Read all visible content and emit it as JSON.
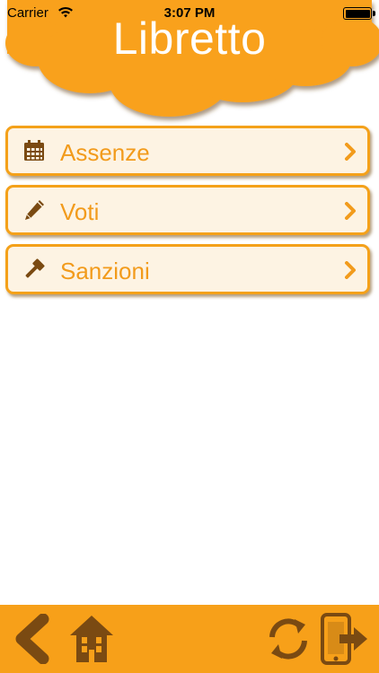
{
  "status_bar": {
    "carrier": "Carrier",
    "time": "3:07 PM"
  },
  "header": {
    "title": "Libretto"
  },
  "menu": {
    "items": [
      {
        "label": "Assenze",
        "icon": "calendar-icon"
      },
      {
        "label": "Voti",
        "icon": "pencil-icon"
      },
      {
        "label": "Sanzioni",
        "icon": "gavel-icon"
      }
    ]
  },
  "toolbar": {
    "buttons": [
      "back-icon",
      "home-icon",
      "refresh-icon",
      "logout-icon"
    ]
  },
  "colors": {
    "accent": "#f7a019",
    "cloud": "#f9a11b",
    "menu_text": "#f29b1c",
    "menu_bg": "#fdf3e3",
    "icon_brown": "#7a4a12"
  }
}
